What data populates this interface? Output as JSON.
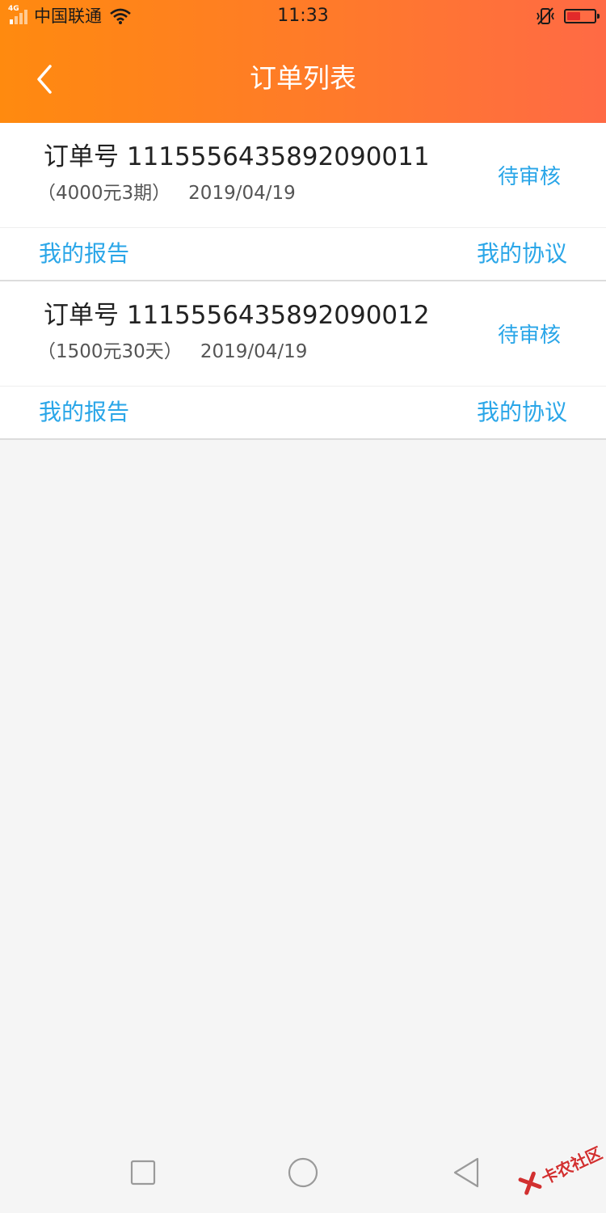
{
  "status_bar": {
    "network": "4G",
    "carrier": "中国联通",
    "time": "11:33",
    "battery_level": 0.45
  },
  "header": {
    "title": "订单列表",
    "back_icon": "chevron-left-icon"
  },
  "orders": [
    {
      "number": "订单号 1115556435892090011",
      "terms": "（4000元3期）",
      "date": "2019/04/19",
      "status": "待审核",
      "report_label": "我的报告",
      "agreement_label": "我的协议"
    },
    {
      "number": "订单号 1115556435892090012",
      "terms": "（1500元30天）",
      "date": "2019/04/19",
      "status": "待审核",
      "report_label": "我的报告",
      "agreement_label": "我的协议"
    }
  ],
  "nav": {
    "recent_icon": "square-icon",
    "home_icon": "circle-icon",
    "back_icon": "triangle-back-icon"
  },
  "watermark": {
    "text": "卡农社区"
  },
  "colors": {
    "header_start": "#ff8a0f",
    "header_end": "#ff6a45",
    "accent": "#2aa6e8"
  }
}
